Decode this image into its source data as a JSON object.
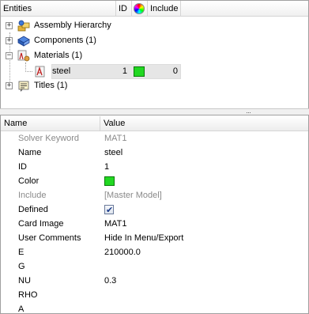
{
  "entity_browser": {
    "headers": {
      "entities": "Entities",
      "id": "ID",
      "include": "Include"
    },
    "tree": [
      {
        "label": "Assembly Hierarchy",
        "expander": "+",
        "icon": "assembly-icon"
      },
      {
        "label": "Components (1)",
        "expander": "+",
        "icon": "components-icon"
      },
      {
        "label": "Materials (1)",
        "expander": "−",
        "icon": "materials-icon"
      },
      {
        "label": "steel",
        "id": "1",
        "include": "0",
        "color": "#22d822",
        "icon": "material-steel-icon"
      },
      {
        "label": "Titles (1)",
        "expander": "+",
        "icon": "titles-icon"
      }
    ]
  },
  "splitter": {
    "grip": "···"
  },
  "properties": {
    "headers": {
      "name": "Name",
      "value": "Value"
    },
    "rows": [
      {
        "name": "Solver Keyword",
        "value": "MAT1"
      },
      {
        "name": "Name",
        "value": "steel"
      },
      {
        "name": "ID",
        "value": "1"
      },
      {
        "name": "Color",
        "value": "",
        "color": "#22d822"
      },
      {
        "name": "Include",
        "value": "[Master Model]"
      },
      {
        "name": "Defined",
        "value": "",
        "checked": true
      },
      {
        "name": "Card Image",
        "value": "MAT1"
      },
      {
        "name": "User Comments",
        "value": "Hide In Menu/Export"
      },
      {
        "name": "E",
        "value": "210000.0"
      },
      {
        "name": "G",
        "value": ""
      },
      {
        "name": "NU",
        "value": "0.3"
      },
      {
        "name": "RHO",
        "value": ""
      },
      {
        "name": "A",
        "value": ""
      }
    ]
  }
}
